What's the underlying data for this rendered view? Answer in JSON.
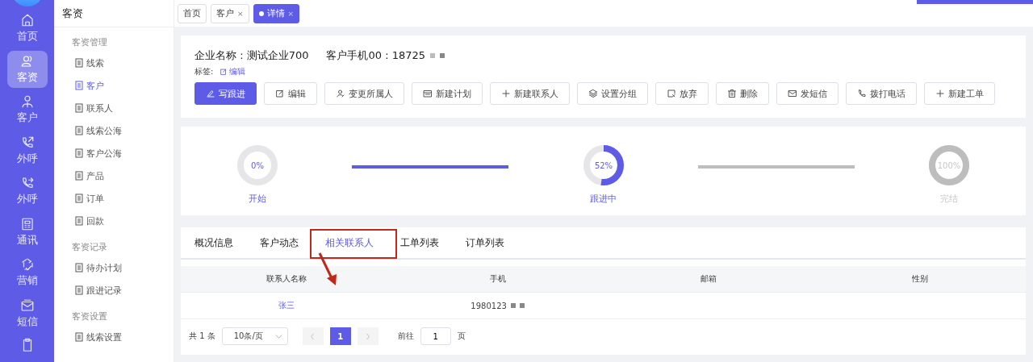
{
  "nav_rail": [
    {
      "label": "首页",
      "selected": false
    },
    {
      "label": "客资",
      "selected": true
    },
    {
      "label": "客户",
      "selected": false
    },
    {
      "label": "外呼",
      "selected": false
    },
    {
      "label": "外呼",
      "selected": false
    },
    {
      "label": "通讯",
      "selected": false
    },
    {
      "label": "营销",
      "selected": false
    },
    {
      "label": "短信",
      "selected": false
    }
  ],
  "sidebar": {
    "title": "客资",
    "groups": [
      {
        "title": "客资管理",
        "items": [
          {
            "label": "线索",
            "selected": false
          },
          {
            "label": "客户",
            "selected": true
          },
          {
            "label": "联系人",
            "selected": false
          },
          {
            "label": "线索公海",
            "selected": false
          },
          {
            "label": "客户公海",
            "selected": false
          },
          {
            "label": "产品",
            "selected": false
          },
          {
            "label": "订单",
            "selected": false
          },
          {
            "label": "回款",
            "selected": false
          }
        ]
      },
      {
        "title": "客资记录",
        "items": [
          {
            "label": "待办计划",
            "selected": false
          },
          {
            "label": "跟进记录",
            "selected": false
          }
        ]
      },
      {
        "title": "客资设置",
        "items": [
          {
            "label": "线索设置",
            "selected": false
          }
        ]
      }
    ]
  },
  "page_tabs": [
    {
      "label": "首页",
      "selected": false
    },
    {
      "label": "客户",
      "close": "×",
      "selected": false
    },
    {
      "label": "详情",
      "close": "×",
      "selected": true
    }
  ],
  "customer": {
    "company": "企业名称 : 测试企业700",
    "phone": "客户手机00 : 18725",
    "tags_label": "标签:",
    "tags_edit": "编辑"
  },
  "actions": [
    {
      "label": "写跟进",
      "kind": "primary"
    },
    {
      "label": "编辑",
      "kind": "default"
    },
    {
      "label": "变更所属人",
      "kind": "default"
    },
    {
      "label": "新建计划",
      "kind": "default"
    },
    {
      "label": "新建联系人",
      "kind": "default"
    },
    {
      "label": "设置分组",
      "kind": "default"
    },
    {
      "label": "放弃",
      "kind": "default"
    },
    {
      "label": "删除",
      "kind": "default"
    },
    {
      "label": "发短信",
      "kind": "default"
    },
    {
      "label": "拨打电话",
      "kind": "default"
    },
    {
      "label": "新建工单",
      "kind": "default"
    }
  ],
  "stages": [
    {
      "percent": "0%",
      "label": "开始",
      "level": 0,
      "reached": true
    },
    {
      "percent": "52%",
      "label": "跟进中",
      "level": 0.52,
      "reached": true
    },
    {
      "percent": "100%",
      "label": "完结",
      "level": 1,
      "reached": false
    }
  ],
  "connectors": [
    {
      "active": true
    },
    {
      "active": false
    }
  ],
  "detail_tabs": [
    {
      "label": "概况信息",
      "selected": false
    },
    {
      "label": "客户动态",
      "selected": false
    },
    {
      "label": "相关联系人",
      "selected": true
    },
    {
      "label": "工单列表",
      "selected": false
    },
    {
      "label": "订单列表",
      "selected": false
    }
  ],
  "table": {
    "columns": [
      "联系人名称",
      "手机",
      "邮箱",
      "性别"
    ],
    "rows": [
      {
        "name": "张三",
        "phone": "1980123"
      }
    ]
  },
  "pagination": {
    "total": "共 1 条",
    "page_size": "10条/页",
    "pages": [
      {
        "label": "1",
        "selected": true
      }
    ],
    "goto_label": "前往",
    "goto_value": "1",
    "page_suffix": "页"
  }
}
